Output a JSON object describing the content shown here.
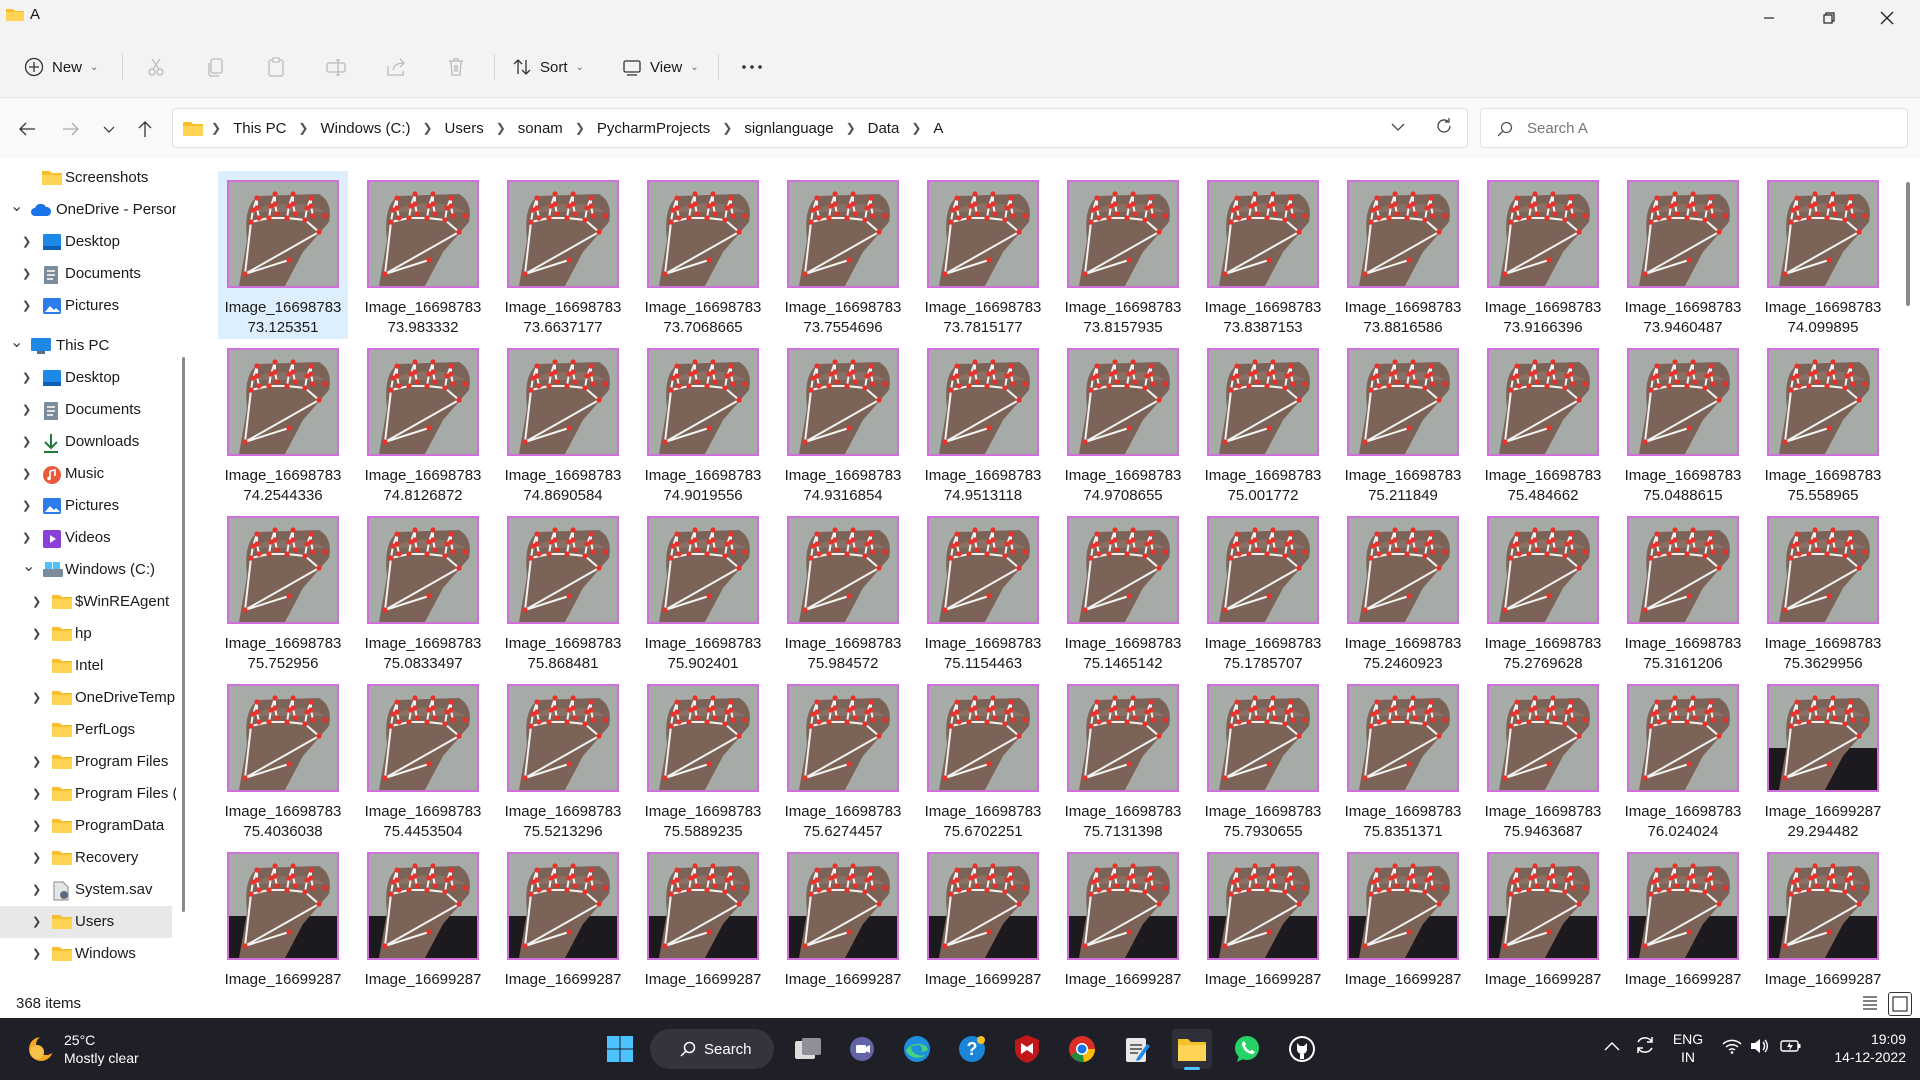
{
  "window": {
    "title": "A"
  },
  "toolbar": {
    "new_label": "New",
    "sort_label": "Sort",
    "view_label": "View"
  },
  "address": {
    "crumbs": [
      "This PC",
      "Windows (C:)",
      "Users",
      "sonam",
      "PycharmProjects",
      "signlanguage",
      "Data",
      "A"
    ]
  },
  "search": {
    "placeholder": "Search A"
  },
  "sidebar": {
    "items": [
      {
        "label": "Screenshots"
      },
      {
        "label": "OneDrive - Person"
      },
      {
        "label": "Desktop"
      },
      {
        "label": "Documents"
      },
      {
        "label": "Pictures"
      },
      {
        "label": "This PC"
      },
      {
        "label": "Desktop"
      },
      {
        "label": "Documents"
      },
      {
        "label": "Downloads"
      },
      {
        "label": "Music"
      },
      {
        "label": "Pictures"
      },
      {
        "label": "Videos"
      },
      {
        "label": "Windows (C:)"
      },
      {
        "label": "$WinREAgent"
      },
      {
        "label": "hp"
      },
      {
        "label": "Intel"
      },
      {
        "label": "OneDriveTemp"
      },
      {
        "label": "PerfLogs"
      },
      {
        "label": "Program Files"
      },
      {
        "label": "Program Files ("
      },
      {
        "label": "ProgramData"
      },
      {
        "label": "Recovery"
      },
      {
        "label": "System.sav"
      },
      {
        "label": "Users"
      },
      {
        "label": "Windows"
      }
    ]
  },
  "files": [
    {
      "l1": "Image_16698783",
      "l2": "73.125351"
    },
    {
      "l1": "Image_16698783",
      "l2": "73.983332"
    },
    {
      "l1": "Image_16698783",
      "l2": "73.6637177"
    },
    {
      "l1": "Image_16698783",
      "l2": "73.7068665"
    },
    {
      "l1": "Image_16698783",
      "l2": "73.7554696"
    },
    {
      "l1": "Image_16698783",
      "l2": "73.7815177"
    },
    {
      "l1": "Image_16698783",
      "l2": "73.8157935"
    },
    {
      "l1": "Image_16698783",
      "l2": "73.8387153"
    },
    {
      "l1": "Image_16698783",
      "l2": "73.8816586"
    },
    {
      "l1": "Image_16698783",
      "l2": "73.9166396"
    },
    {
      "l1": "Image_16698783",
      "l2": "73.9460487"
    },
    {
      "l1": "Image_16698783",
      "l2": "74.099895"
    },
    {
      "l1": "Image_16698783",
      "l2": "74.2544336"
    },
    {
      "l1": "Image_16698783",
      "l2": "74.8126872"
    },
    {
      "l1": "Image_16698783",
      "l2": "74.8690584"
    },
    {
      "l1": "Image_16698783",
      "l2": "74.9019556"
    },
    {
      "l1": "Image_16698783",
      "l2": "74.9316854"
    },
    {
      "l1": "Image_16698783",
      "l2": "74.9513118"
    },
    {
      "l1": "Image_16698783",
      "l2": "74.9708655"
    },
    {
      "l1": "Image_16698783",
      "l2": "75.001772"
    },
    {
      "l1": "Image_16698783",
      "l2": "75.211849"
    },
    {
      "l1": "Image_16698783",
      "l2": "75.484662"
    },
    {
      "l1": "Image_16698783",
      "l2": "75.0488615"
    },
    {
      "l1": "Image_16698783",
      "l2": "75.558965"
    },
    {
      "l1": "Image_16698783",
      "l2": "75.752956"
    },
    {
      "l1": "Image_16698783",
      "l2": "75.0833497"
    },
    {
      "l1": "Image_16698783",
      "l2": "75.868481"
    },
    {
      "l1": "Image_16698783",
      "l2": "75.902401"
    },
    {
      "l1": "Image_16698783",
      "l2": "75.984572"
    },
    {
      "l1": "Image_16698783",
      "l2": "75.1154463"
    },
    {
      "l1": "Image_16698783",
      "l2": "75.1465142"
    },
    {
      "l1": "Image_16698783",
      "l2": "75.1785707"
    },
    {
      "l1": "Image_16698783",
      "l2": "75.2460923"
    },
    {
      "l1": "Image_16698783",
      "l2": "75.2769628"
    },
    {
      "l1": "Image_16698783",
      "l2": "75.3161206"
    },
    {
      "l1": "Image_16698783",
      "l2": "75.3629956"
    },
    {
      "l1": "Image_16698783",
      "l2": "75.4036038"
    },
    {
      "l1": "Image_16698783",
      "l2": "75.4453504"
    },
    {
      "l1": "Image_16698783",
      "l2": "75.5213296"
    },
    {
      "l1": "Image_16698783",
      "l2": "75.5889235"
    },
    {
      "l1": "Image_16698783",
      "l2": "75.6274457"
    },
    {
      "l1": "Image_16698783",
      "l2": "75.6702251"
    },
    {
      "l1": "Image_16698783",
      "l2": "75.7131398"
    },
    {
      "l1": "Image_16698783",
      "l2": "75.7930655"
    },
    {
      "l1": "Image_16698783",
      "l2": "75.8351371"
    },
    {
      "l1": "Image_16698783",
      "l2": "75.9463687"
    },
    {
      "l1": "Image_16698783",
      "l2": "76.024024"
    },
    {
      "l1": "Image_16699287",
      "l2": "29.294482"
    },
    {
      "l1": "Image_16699287",
      "l2": ""
    },
    {
      "l1": "Image_16699287",
      "l2": ""
    },
    {
      "l1": "Image_16699287",
      "l2": ""
    },
    {
      "l1": "Image_16699287",
      "l2": ""
    },
    {
      "l1": "Image_16699287",
      "l2": ""
    },
    {
      "l1": "Image_16699287",
      "l2": ""
    },
    {
      "l1": "Image_16699287",
      "l2": ""
    },
    {
      "l1": "Image_16699287",
      "l2": ""
    },
    {
      "l1": "Image_16699287",
      "l2": ""
    },
    {
      "l1": "Image_16699287",
      "l2": ""
    },
    {
      "l1": "Image_16699287",
      "l2": ""
    },
    {
      "l1": "Image_16699287",
      "l2": ""
    }
  ],
  "status": {
    "count": "368 items"
  },
  "taskbar": {
    "weather_temp": "25°C",
    "weather_desc": "Mostly clear",
    "search_label": "Search",
    "lang1": "ENG",
    "lang2": "IN",
    "time": "19:09",
    "date": "14-12-2022"
  },
  "colors": {
    "accent": "#0067c0",
    "thumb_border": "#d16fd9",
    "landmark": "#e8312b",
    "taskbar": "#1f1f27"
  }
}
